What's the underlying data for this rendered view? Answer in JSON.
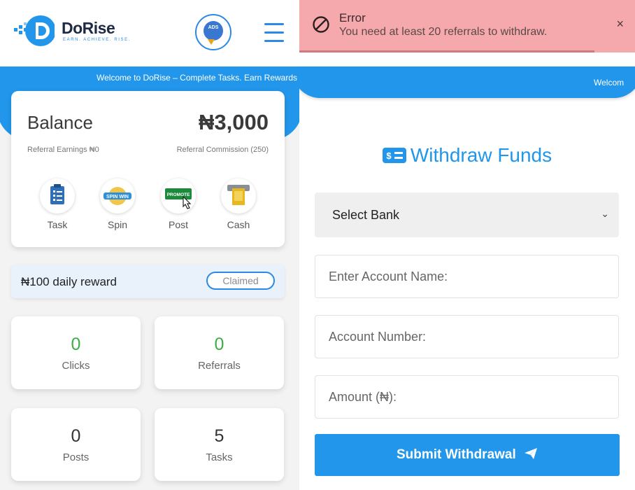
{
  "app": {
    "brand": "DoRise",
    "tagline": "EARN. ACHIEVE. RISE.",
    "ads_badge": "ADS"
  },
  "left_screen": {
    "marquee": "Welcome to DoRise – Complete Tasks. Earn Rewards",
    "balance": {
      "label": "Balance",
      "value": "₦3,000",
      "referral_earnings": "Referral Earnings ₦0",
      "referral_commission": "Referral Commission (250)"
    },
    "actions": [
      {
        "label": "Task",
        "icon": "clipboard-icon"
      },
      {
        "label": "Spin",
        "icon": "spin-win-icon",
        "badge": "SPIN WIN"
      },
      {
        "label": "Post",
        "icon": "promote-icon",
        "badge": "PROMOTE"
      },
      {
        "label": "Cash",
        "icon": "cash-icon"
      }
    ],
    "daily_reward": {
      "text": "₦100 daily reward",
      "button": "Claimed"
    },
    "stats": [
      {
        "value": "0",
        "label": "Clicks",
        "color": "#3cae47"
      },
      {
        "value": "0",
        "label": "Referrals",
        "color": "#3cae47"
      },
      {
        "value": "0",
        "label": "Posts",
        "color": "#333333"
      },
      {
        "value": "5",
        "label": "Tasks",
        "color": "#333333"
      }
    ]
  },
  "right_screen": {
    "marquee": "Welcom",
    "toast": {
      "title": "Error",
      "message": "You need at least 20 referrals to withdraw.",
      "close": "×",
      "icon": "blocked-icon",
      "color": "#f6a9ad"
    },
    "title": "Withdraw Funds",
    "title_icon": "money-icon",
    "form": {
      "bank_select": "Select Bank",
      "account_name_placeholder": "Enter Account Name:",
      "account_number_placeholder": "Account Number:",
      "amount_placeholder": "Amount (₦):",
      "submit": "Submit Withdrawal"
    }
  },
  "colors": {
    "accent": "#2196ea",
    "success": "#3cae47"
  }
}
